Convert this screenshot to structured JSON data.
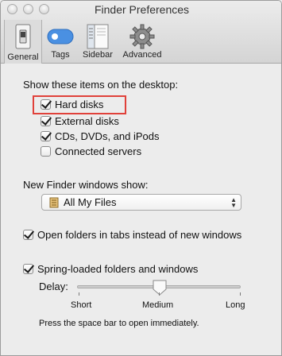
{
  "window": {
    "title": "Finder Preferences"
  },
  "toolbar": {
    "items": [
      {
        "label": "General",
        "icon": "switch-icon",
        "selected": true
      },
      {
        "label": "Tags",
        "icon": "tag-icon"
      },
      {
        "label": "Sidebar",
        "icon": "sidebar-icon"
      },
      {
        "label": "Advanced",
        "icon": "gear-icon"
      }
    ]
  },
  "desktop": {
    "heading": "Show these items on the desktop:",
    "items": [
      {
        "label": "Hard disks",
        "checked": true
      },
      {
        "label": "External disks",
        "checked": true
      },
      {
        "label": "CDs, DVDs, and iPods",
        "checked": true
      },
      {
        "label": "Connected servers",
        "checked": false
      }
    ]
  },
  "new_window": {
    "label": "New Finder windows show:",
    "selected": "All My Files"
  },
  "tabs_option": {
    "label": "Open folders in tabs instead of new windows",
    "checked": true
  },
  "spring": {
    "label": "Spring-loaded folders and windows",
    "checked": true,
    "delay_label": "Delay:",
    "delay_level": "Medium",
    "ticks": [
      "Short",
      "Medium",
      "Long"
    ],
    "hint": "Press the space bar to open immediately."
  },
  "colors": {
    "highlight": "#e0413a"
  }
}
